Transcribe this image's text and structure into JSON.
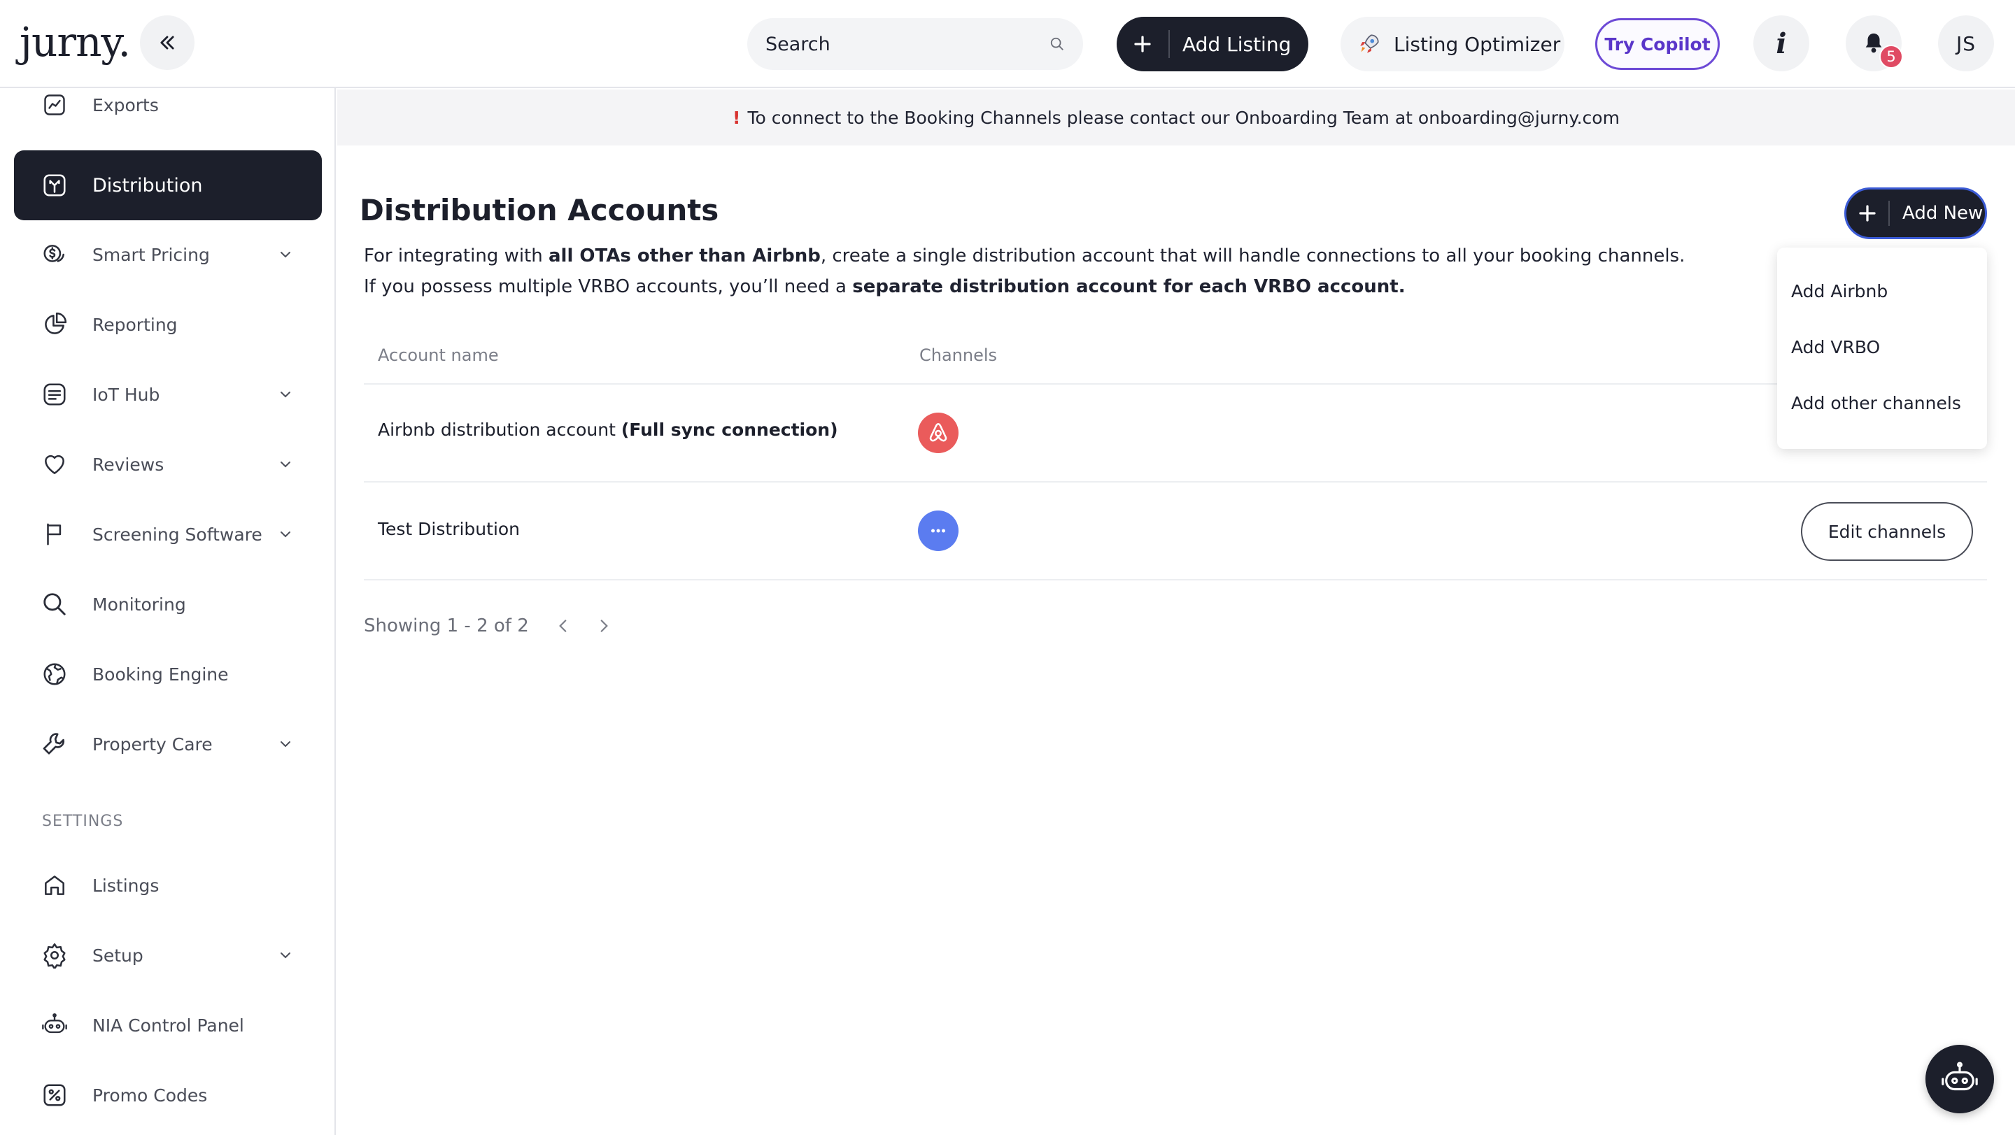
{
  "header": {
    "logo": "jurny.",
    "search": {
      "placeholder": "Search",
      "value": ""
    },
    "add_listing_label": "Add Listing",
    "optimizer_label": "Listing Optimizer",
    "copilot_label": "Try Copilot",
    "info_label": "i",
    "notifications_count": "5",
    "avatar_initials": "JS"
  },
  "sidebar": {
    "items": [
      {
        "label": "Exports",
        "icon": "chart-icon"
      },
      {
        "label": "Distribution",
        "icon": "distribution-icon",
        "active": true
      },
      {
        "label": "Smart Pricing",
        "icon": "dollar-icon",
        "chevron": true
      },
      {
        "label": "Reporting",
        "icon": "pie-chart-icon"
      },
      {
        "label": "IoT Hub",
        "icon": "iot-icon",
        "chevron": true
      },
      {
        "label": "Reviews",
        "icon": "heart-icon",
        "chevron": true
      },
      {
        "label": "Screening Software",
        "icon": "flag-icon",
        "chevron": true
      },
      {
        "label": "Monitoring",
        "icon": "search-icon"
      },
      {
        "label": "Booking Engine",
        "icon": "globe-icon"
      },
      {
        "label": "Property Care",
        "icon": "wrench-icon",
        "chevron": true
      }
    ],
    "settings_label": "SETTINGS",
    "settings_items": [
      {
        "label": "Listings",
        "icon": "home-icon"
      },
      {
        "label": "Setup",
        "icon": "gear-icon",
        "chevron": true
      },
      {
        "label": "NIA Control Panel",
        "icon": "robot-icon"
      },
      {
        "label": "Promo Codes",
        "icon": "percent-icon"
      }
    ]
  },
  "notice": {
    "icon": "!",
    "text": "To connect to the Booking Channels please contact our Onboarding Team at onboarding@jurny.com"
  },
  "main": {
    "title": "Distribution Accounts",
    "desc_line1_a": "For integrating with ",
    "desc_line1_b": "all OTAs other than Airbnb",
    "desc_line1_c": ", create a single distribution account that will handle connections to all your booking channels.",
    "desc_line2_a": "If you possess multiple VRBO accounts, you’ll need a ",
    "desc_line2_b": "separate distribution account for each VRBO account.",
    "add_new_label": "Add New",
    "dropdown": [
      "Add Airbnb",
      "Add VRBO",
      "Add other channels"
    ],
    "table": {
      "headers": {
        "account": "Account name",
        "channels": "Channels"
      },
      "rows": [
        {
          "name": "Airbnb distribution account ",
          "name_bold": "(Full sync connection)",
          "channel_icon": "airbnb-icon",
          "channel_color": "#ea5b5b"
        },
        {
          "name": "Test Distribution",
          "name_bold": "",
          "channel_icon": "more-icon",
          "channel_color": "#5b7cf0",
          "action": "Edit channels"
        }
      ]
    },
    "pagination": "Showing 1 - 2 of 2"
  },
  "colors": {
    "dark": "#1c1f2b",
    "accent_blue": "#3b5bd6",
    "copilot_purple": "#6d4ad6",
    "badge": "#e04a63"
  }
}
